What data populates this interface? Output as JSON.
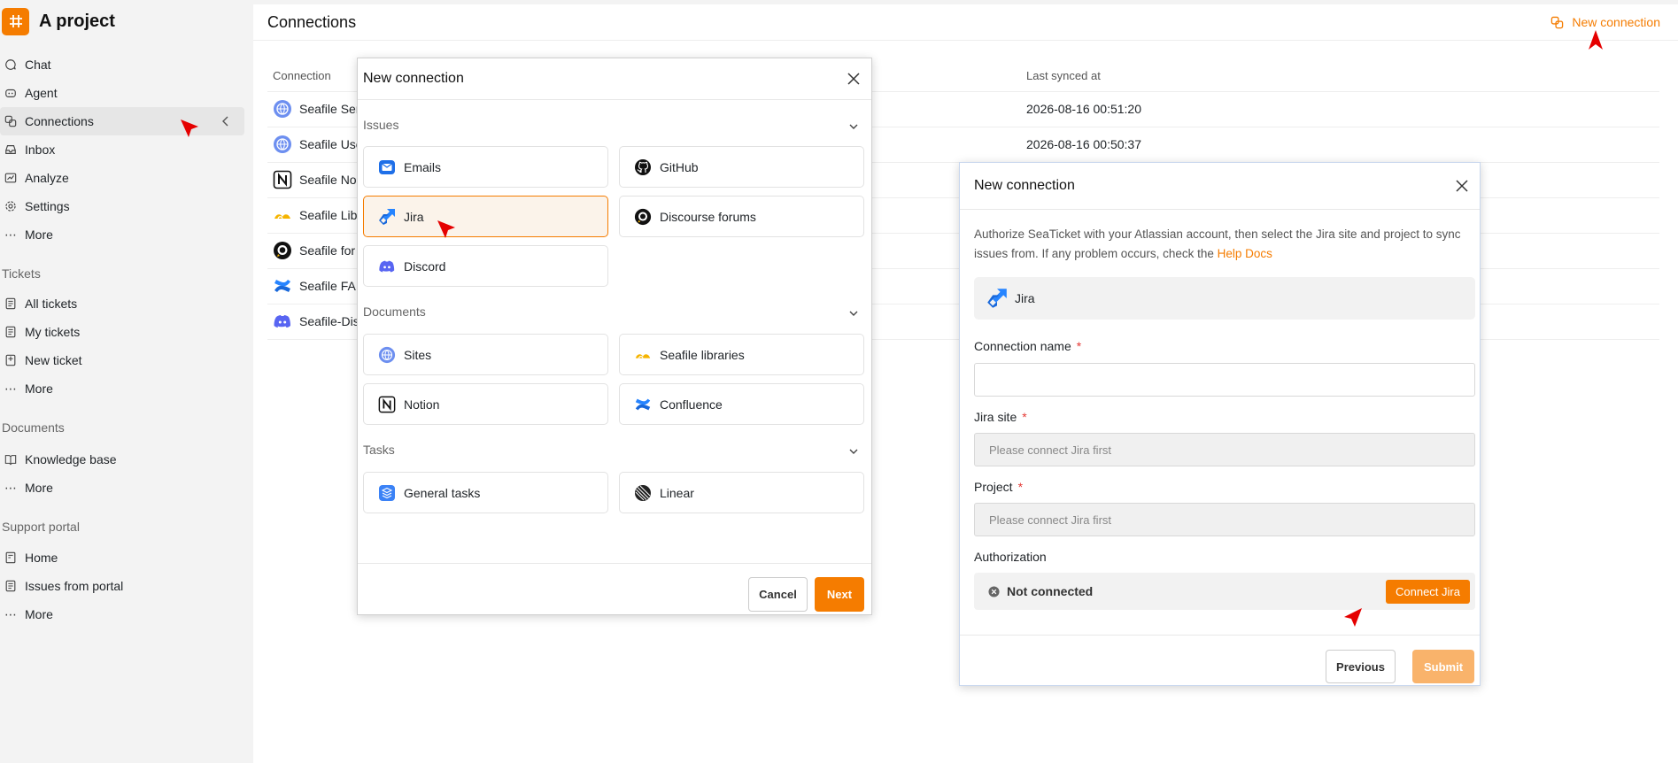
{
  "project": {
    "name": "A project"
  },
  "sidebar": {
    "main_items": [
      {
        "label": "Chat",
        "icon": "chat-icon"
      },
      {
        "label": "Agent",
        "icon": "agent-icon"
      },
      {
        "label": "Connections",
        "icon": "connections-icon",
        "active": true
      },
      {
        "label": "Inbox",
        "icon": "inbox-icon"
      },
      {
        "label": "Analyze",
        "icon": "analyze-icon"
      },
      {
        "label": "Settings",
        "icon": "settings-icon"
      },
      {
        "label": "More",
        "icon": "more-icon"
      }
    ],
    "tickets": {
      "title": "Tickets",
      "items": [
        {
          "label": "All tickets",
          "icon": "list-icon"
        },
        {
          "label": "My tickets",
          "icon": "list-icon"
        },
        {
          "label": "New ticket",
          "icon": "new-ticket-icon"
        },
        {
          "label": "More",
          "icon": "more-icon"
        }
      ]
    },
    "documents": {
      "title": "Documents",
      "items": [
        {
          "label": "Knowledge base",
          "icon": "book-icon"
        },
        {
          "label": "More",
          "icon": "more-icon"
        }
      ]
    },
    "portal": {
      "title": "Support portal",
      "items": [
        {
          "label": "Home",
          "icon": "home-icon"
        },
        {
          "label": "Issues from portal",
          "icon": "list-icon"
        },
        {
          "label": "More",
          "icon": "more-icon"
        }
      ]
    }
  },
  "main": {
    "title": "Connections",
    "new_connection_label": "New connection",
    "table": {
      "headers": [
        "Connection",
        "Last synced at"
      ],
      "rows": [
        {
          "name": "Seafile Ser",
          "synced": "2026-08-16 00:51:20",
          "icon": "sites-icon"
        },
        {
          "name": "Seafile Use",
          "synced": "2026-08-16 00:50:37",
          "icon": "sites-icon"
        },
        {
          "name": "Seafile No",
          "synced": "",
          "icon": "notion-icon"
        },
        {
          "name": "Seafile Lib",
          "synced": "",
          "icon": "seafile-icon"
        },
        {
          "name": "Seafile for",
          "synced": "",
          "icon": "discourse-icon"
        },
        {
          "name": "Seafile FA",
          "synced": "",
          "icon": "confluence-icon"
        },
        {
          "name": "Seafile-Dis",
          "synced": "",
          "icon": "discord-icon"
        }
      ]
    }
  },
  "modal1": {
    "title": "New connection",
    "groups": [
      {
        "title": "Issues",
        "items": [
          {
            "label": "Emails",
            "icon": "email-icon"
          },
          {
            "label": "GitHub",
            "icon": "github-icon"
          },
          {
            "label": "Jira",
            "icon": "jira-icon",
            "selected": true
          },
          {
            "label": "Discourse forums",
            "icon": "discourse-icon"
          },
          {
            "label": "Discord",
            "icon": "discord-icon"
          }
        ]
      },
      {
        "title": "Documents",
        "items": [
          {
            "label": "Sites",
            "icon": "sites-icon"
          },
          {
            "label": "Seafile libraries",
            "icon": "seafile-icon"
          },
          {
            "label": "Notion",
            "icon": "notion-icon"
          },
          {
            "label": "Confluence",
            "icon": "confluence-icon"
          }
        ]
      },
      {
        "title": "Tasks",
        "items": [
          {
            "label": "General tasks",
            "icon": "tasks-icon"
          },
          {
            "label": "Linear",
            "icon": "linear-icon"
          }
        ]
      }
    ],
    "cancel": "Cancel",
    "next": "Next"
  },
  "modal2": {
    "title": "New connection",
    "desc_1": "Authorize SeaTicket with your Atlassian account, then select the Jira site and project to sync issues from. If any problem occurs, check the ",
    "desc_link": "Help Docs",
    "source": "Jira",
    "fields": {
      "name_label": "Connection name",
      "name_value": "",
      "site_label": "Jira site",
      "site_placeholder": "Please connect Jira first",
      "project_label": "Project",
      "project_placeholder": "Please connect Jira first",
      "required_mark": "*"
    },
    "auth_label": "Authorization",
    "auth_status": "Not connected",
    "connect": "Connect Jira",
    "previous": "Previous",
    "submit": "Submit"
  },
  "colors": {
    "accent": "#f57c00",
    "accent_light": "#f9b36b"
  }
}
